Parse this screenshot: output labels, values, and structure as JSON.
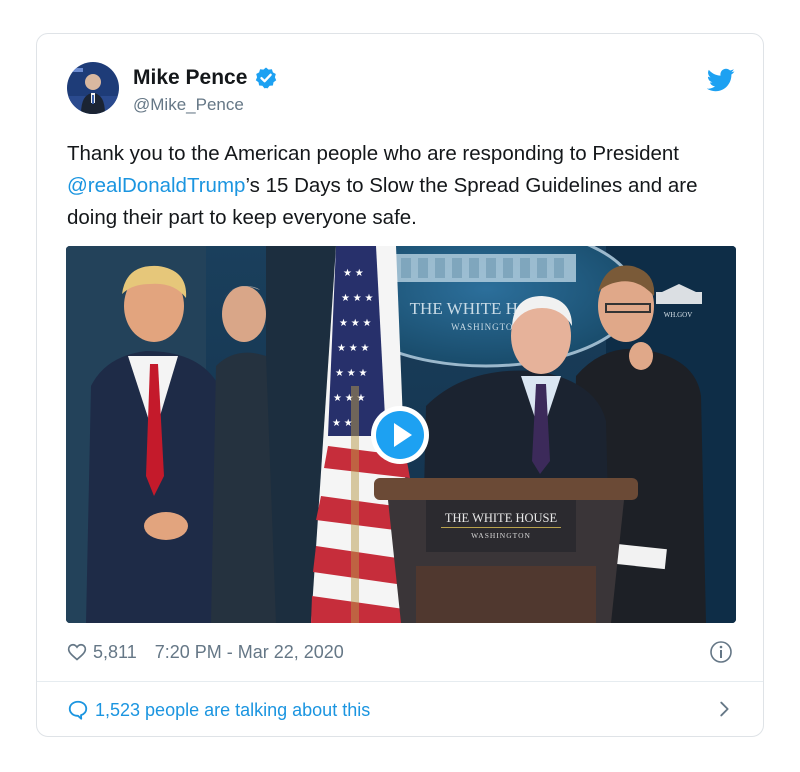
{
  "tweet": {
    "author_name": "Mike Pence",
    "author_handle": "@Mike_Pence",
    "text_before": "Thank you to the American people who are responding to President ",
    "mention": "@realDonaldTrump",
    "text_after": "’s 15 Days to Slow the Spread Guidelines and are doing their part to keep everyone safe.",
    "likes": "5,811",
    "timestamp": "7:20 PM - Mar 22, 2020",
    "talking": "1,523 people are talking about this"
  },
  "media": {
    "seal_title": "THE WHITE HOUSE",
    "seal_subtitle": "WASHINGTON",
    "podium_title": "THE WHITE HOUSE",
    "podium_subtitle": "WASHINGTON",
    "watermark": "WH.GOV"
  },
  "icons": {
    "verified": "verified-badge-icon",
    "bird": "twitter-bird-icon",
    "heart": "heart-icon",
    "info": "info-icon",
    "bubble": "speech-bubble-icon",
    "chevron": "chevron-right-icon",
    "play": "play-icon"
  },
  "colors": {
    "link": "#1b95e0",
    "muted": "#657786",
    "text": "#14171a"
  }
}
